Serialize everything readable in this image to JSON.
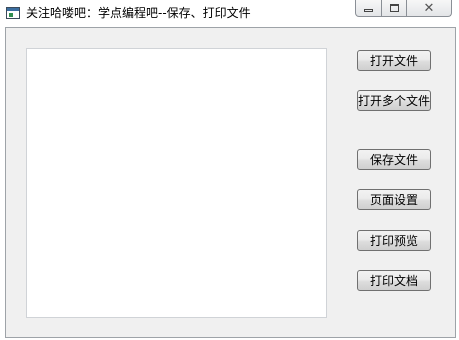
{
  "window": {
    "title": "关注哈喽吧：学点编程吧--保存、打印文件"
  },
  "controls": {
    "minimize_icon": "minimize-icon",
    "maximize_icon": "maximize-icon",
    "close_icon": "close-icon",
    "close_glyph": "✕"
  },
  "editor": {
    "text": ""
  },
  "buttons": {
    "open_file": "打开文件",
    "open_multiple": "打开多个文件",
    "save_file": "保存文件",
    "page_setup": "页面设置",
    "print_preview": "打印预览",
    "print_document": "打印文档"
  },
  "colors": {
    "client_background": "#f0f0f0",
    "window_border": "#9ea3a8"
  }
}
